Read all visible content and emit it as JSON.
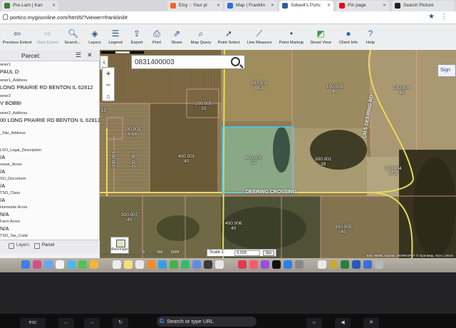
{
  "browser": {
    "tabs": [
      {
        "label": "Pre-Lam | Kan",
        "color": "#3a7d3a"
      },
      {
        "label": "Etsy :: Your pl",
        "color": "#f16521"
      },
      {
        "label": "Map | Franklin",
        "color": "#2d6cdf"
      },
      {
        "label": "Sidwell's Portc",
        "color": "#2f5d93"
      },
      {
        "label": "Pin page",
        "color": "#e60023"
      },
      {
        "label": "Search Picture",
        "color": "#222222"
      }
    ],
    "url": "portico.mygisonline.com/html5/?viewer=franklinil#"
  },
  "toolbar": {
    "items": [
      {
        "label": "Previous Extent",
        "icon": "back-arrow-icon",
        "enabled": true
      },
      {
        "label": "Next Extent",
        "icon": "forward-arrow-icon",
        "enabled": false
      },
      {
        "label": "Search...",
        "icon": "magnifier-icon",
        "enabled": true
      },
      {
        "label": "Layers",
        "icon": "layers-icon",
        "enabled": true
      },
      {
        "label": "Legend",
        "icon": "legend-icon",
        "enabled": true
      },
      {
        "label": "Export",
        "icon": "export-icon",
        "enabled": true
      },
      {
        "label": "Print",
        "icon": "printer-icon",
        "enabled": true
      },
      {
        "label": "Share",
        "icon": "share-icon",
        "enabled": true
      },
      {
        "label": "Map Query",
        "icon": "query-icon",
        "enabled": true
      },
      {
        "label": "Point Select",
        "icon": "point-select-icon",
        "enabled": true
      },
      {
        "label": "Line Measure",
        "icon": "line-measure-icon",
        "enabled": true
      },
      {
        "label": "Point Markup",
        "icon": "point-markup-icon",
        "enabled": true
      },
      {
        "label": "Street View",
        "icon": "street-view-icon",
        "enabled": true
      },
      {
        "label": "Client Info",
        "icon": "info-icon",
        "enabled": true
      },
      {
        "label": "Help",
        "icon": "help-icon",
        "enabled": true
      }
    ]
  },
  "panel": {
    "title": "Parcel:",
    "fields": [
      {
        "name": "wner1",
        "value": "PAUL D"
      },
      {
        "name": "wner1_Address",
        "value": "LONG PRAIRIE RD BENTON IL 62812"
      },
      {
        "name": "wner2",
        "value": "V BOBBI"
      },
      {
        "name": "wner2_Address",
        "value": "00 LONG PRAIRIE RD BENTON IL 62812"
      },
      {
        "name": "_Site_Address",
        "value": ""
      },
      {
        "name": "LSO_Legal_Description",
        "value": "/A"
      },
      {
        "name": "rease_Acres",
        "value": "/A"
      },
      {
        "name": "SO_Document",
        "value": "/A"
      },
      {
        "name": "TSO_Class",
        "value": "/A"
      },
      {
        "name": "Homesite Acres",
        "value": "N/A"
      },
      {
        "name": "Farm Acres",
        "value": "N/A"
      },
      {
        "name": "TSO_Tax_Code",
        "value": ""
      }
    ],
    "tabs": [
      "Layers",
      "Parcel"
    ]
  },
  "map": {
    "search_value": "0831400003",
    "sign_in": "Sign",
    "parcels": [
      {
        "id": "200.001",
        "acres": "88.5"
      },
      {
        "id": "100.001",
        "acres": "40"
      },
      {
        "id": "100.004",
        "acres": "40"
      },
      {
        "id": "200.005",
        "acres": "10"
      },
      {
        "id": "200.003",
        "acres": "4.66"
      },
      {
        "id": "400.001",
        "acres": "40"
      },
      {
        "id": "400.001",
        "acres": "35"
      },
      {
        "id": "300.001",
        "acres": "39"
      },
      {
        "id": "300.004",
        "acres": "37.5"
      },
      {
        "id": "300.007",
        "acres": "40"
      },
      {
        "id": "400.006",
        "acres": "40"
      },
      {
        "id": "300.005",
        "acres": "40"
      }
    ],
    "left_labels": [
      "014",
      "133",
      "15"
    ],
    "vert_labels": [
      "400.001",
      "200.007"
    ],
    "roads": [
      "DEERING CROSSING",
      "CH 5 DEERING RD"
    ],
    "basemaps_label": "Basemaps",
    "scale_ticks": [
      "0",
      "300",
      "600ft"
    ],
    "scale_label": "Scale 1:",
    "scale_value": "9,028",
    "scale_go": "Go",
    "attribution": "Esri, HERE, Garmin, WORKSPRT © OpenMap, NGA, USGS",
    "footer": "Terms, Map Service Notice & Terms of use"
  },
  "touchbar": {
    "esc": "esc",
    "search": "Search or type URL"
  }
}
